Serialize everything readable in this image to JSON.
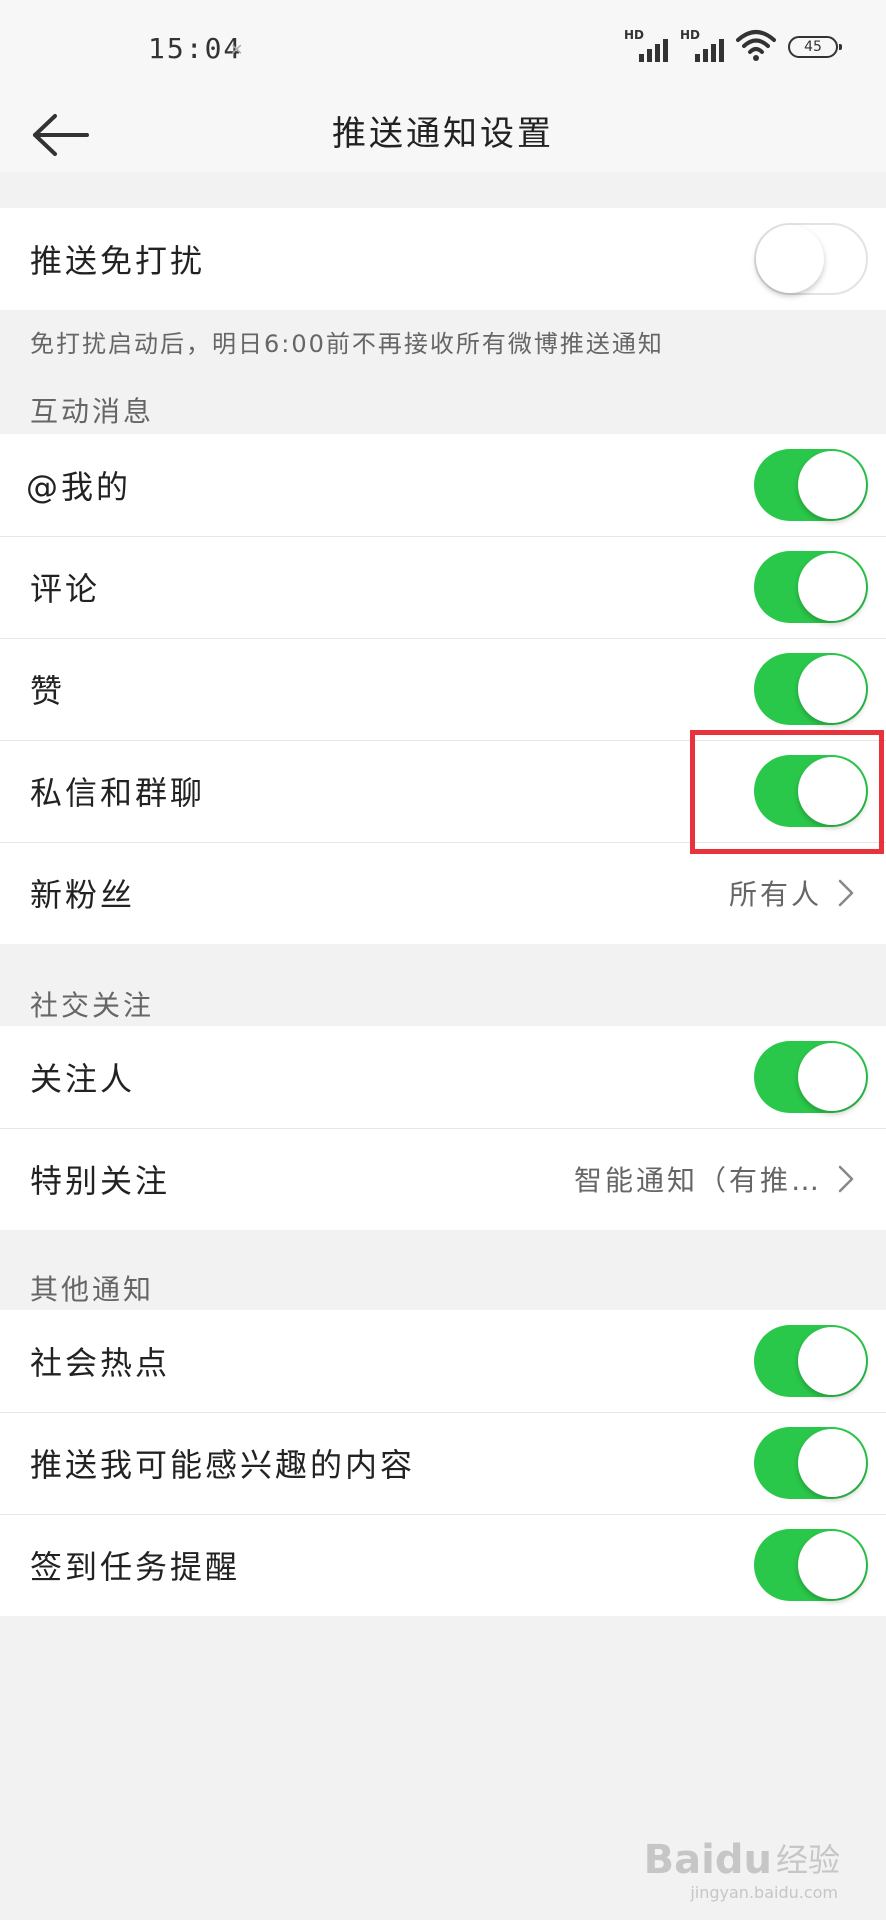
{
  "status_bar": {
    "time": "15:04",
    "time_mark": "✕",
    "signal_label": "HD",
    "battery": "45"
  },
  "header": {
    "title": "推送通知设置",
    "back_icon": "arrow-left-icon"
  },
  "dnd": {
    "label": "推送免打扰",
    "enabled": false,
    "note": "免打扰启动后，明日6:00前不再接收所有微博推送通知"
  },
  "sections": [
    {
      "header": "互动消息",
      "items": [
        {
          "label": "@我的",
          "type": "toggle",
          "on": true
        },
        {
          "label": "评论",
          "type": "toggle",
          "on": true
        },
        {
          "label": "赞",
          "type": "toggle",
          "on": true
        },
        {
          "label": "私信和群聊",
          "type": "toggle",
          "on": true
        },
        {
          "label": "新粉丝",
          "type": "select",
          "value": "所有人"
        }
      ]
    },
    {
      "header": "社交关注",
      "items": [
        {
          "label": "关注人",
          "type": "toggle",
          "on": true
        },
        {
          "label": "特别关注",
          "type": "select",
          "value": "智能通知（有推…"
        }
      ]
    },
    {
      "header": "其他通知",
      "items": [
        {
          "label": "社会热点",
          "type": "toggle",
          "on": true
        },
        {
          "label": "推送我可能感兴趣的内容",
          "type": "toggle",
          "on": true
        },
        {
          "label": "签到任务提醒",
          "type": "toggle",
          "on": true
        }
      ]
    }
  ],
  "colors": {
    "toggle_on": "#2ac84a",
    "highlight": "#e8323c"
  },
  "watermark": {
    "brand": "Baidu",
    "sub": "经验",
    "url": "jingyan.baidu.com"
  }
}
